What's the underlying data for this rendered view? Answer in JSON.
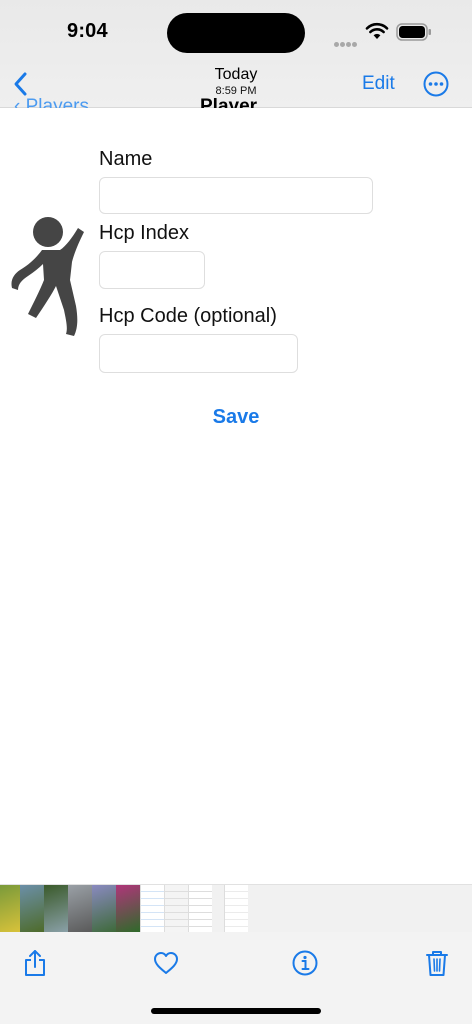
{
  "status_bar": {
    "time": "9:04"
  },
  "viewer_nav": {
    "title": "Today",
    "subtitle": "8:59 PM",
    "edit_label": "Edit",
    "back_icon": "chevron-left-icon",
    "more_icon": "ellipsis-circle-icon"
  },
  "captured_app": {
    "back_label": "Players",
    "title": "Player",
    "icon": "golfer-icon",
    "form": {
      "name_label": "Name",
      "name_value": "",
      "hcp_index_label": "Hcp Index",
      "hcp_index_value": "",
      "hcp_code_label": "Hcp Code (optional)",
      "hcp_code_value": "",
      "save_label": "Save"
    }
  },
  "thumbnails": [
    {
      "kind": "photo",
      "colors": [
        "#7a9a3a",
        "#d8c23a"
      ]
    },
    {
      "kind": "photo",
      "colors": [
        "#6b8fa8",
        "#4e6b2a"
      ]
    },
    {
      "kind": "photo",
      "colors": [
        "#3a5a2a",
        "#8aa0a8"
      ]
    },
    {
      "kind": "photo",
      "colors": [
        "#9aa0a6",
        "#5a5a5a"
      ]
    },
    {
      "kind": "photo",
      "colors": [
        "#8a8ac0",
        "#3e6a3a"
      ]
    },
    {
      "kind": "photo",
      "colors": [
        "#b0357a",
        "#2f6a2a"
      ]
    },
    {
      "kind": "document",
      "colors": [
        "#ffffff",
        "#2a7ad0"
      ]
    },
    {
      "kind": "document",
      "colors": [
        "#f4f4f4",
        "#888888"
      ]
    },
    {
      "kind": "document",
      "colors": [
        "#ffffff",
        "#555555"
      ]
    },
    {
      "kind": "screenshot",
      "colors": [
        "#ffffff",
        "#9a9a9a"
      ]
    }
  ],
  "toolbar": {
    "share_icon": "share-icon",
    "favorite_icon": "heart-icon",
    "info_icon": "info-icon",
    "delete_icon": "trash-icon"
  },
  "colors": {
    "accent": "#1a7ae8",
    "golfer": "#454545"
  }
}
